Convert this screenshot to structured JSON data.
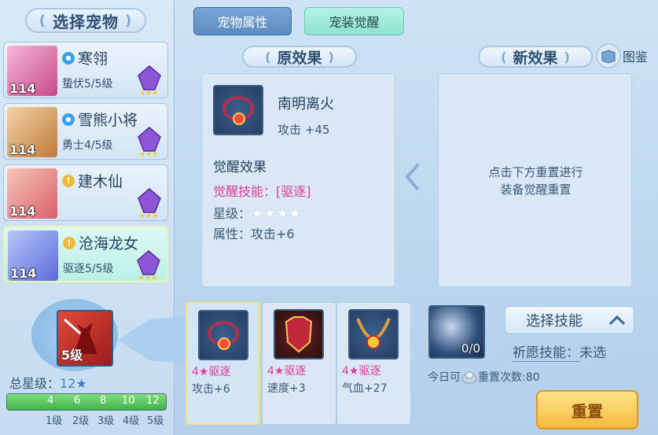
{
  "left": {
    "title": "选择宠物",
    "pets": [
      {
        "level": "114",
        "name": "寒翎",
        "sub": "蛰伏5/5级",
        "type": "water"
      },
      {
        "level": "114",
        "name": "雪熊小将",
        "sub": "勇士4/5级",
        "type": "water"
      },
      {
        "level": "114",
        "name": "建木仙",
        "sub": "",
        "type": "gold"
      },
      {
        "level": "114",
        "name": "沧海龙女",
        "sub": "驱逐5/5级",
        "type": "gold"
      }
    ],
    "skill_level": "5级",
    "total_star_label": "总星级：",
    "total_star_value": "12★",
    "progress_fraction": 1.0,
    "ticks": [
      "4",
      "6",
      "8",
      "10",
      "12"
    ],
    "tick_labels": [
      "1级",
      "2级",
      "3级",
      "4级",
      "5级"
    ]
  },
  "tabs": {
    "pet_attr": "宠物属性",
    "pet_equip_awaken": "宠装觉醒"
  },
  "original": {
    "title": "原效果",
    "equip_name": "南明离火",
    "equip_stat": "攻击 +45",
    "awaken_title": "觉醒效果",
    "awaken_skill_label": "觉醒技能：",
    "awaken_skill_value": "[驱逐]",
    "star_label": "星级：",
    "star_value": "★★★★",
    "attr_label": "属性：",
    "attr_value": "攻击+6"
  },
  "new": {
    "title": "新效果",
    "handbook": "图鉴",
    "hint_line1": "点击下方重置进行",
    "hint_line2": "装备觉醒重置"
  },
  "slots": [
    {
      "name": "4★驱逐",
      "val": "攻击+6"
    },
    {
      "name": "4★驱逐",
      "val": "速度+3"
    },
    {
      "name": "4★驱逐",
      "val": "气血+27"
    }
  ],
  "reset": {
    "orb_count": "0/0",
    "select_skill": "选择技能",
    "pray_label": "祈愿技能：",
    "pray_value": "未选",
    "today_label": "今日可",
    "reset_times": "重置次数:80",
    "button": "重置"
  },
  "colors": {
    "accent": "#e03a9a",
    "gold": "#f4b93c"
  }
}
